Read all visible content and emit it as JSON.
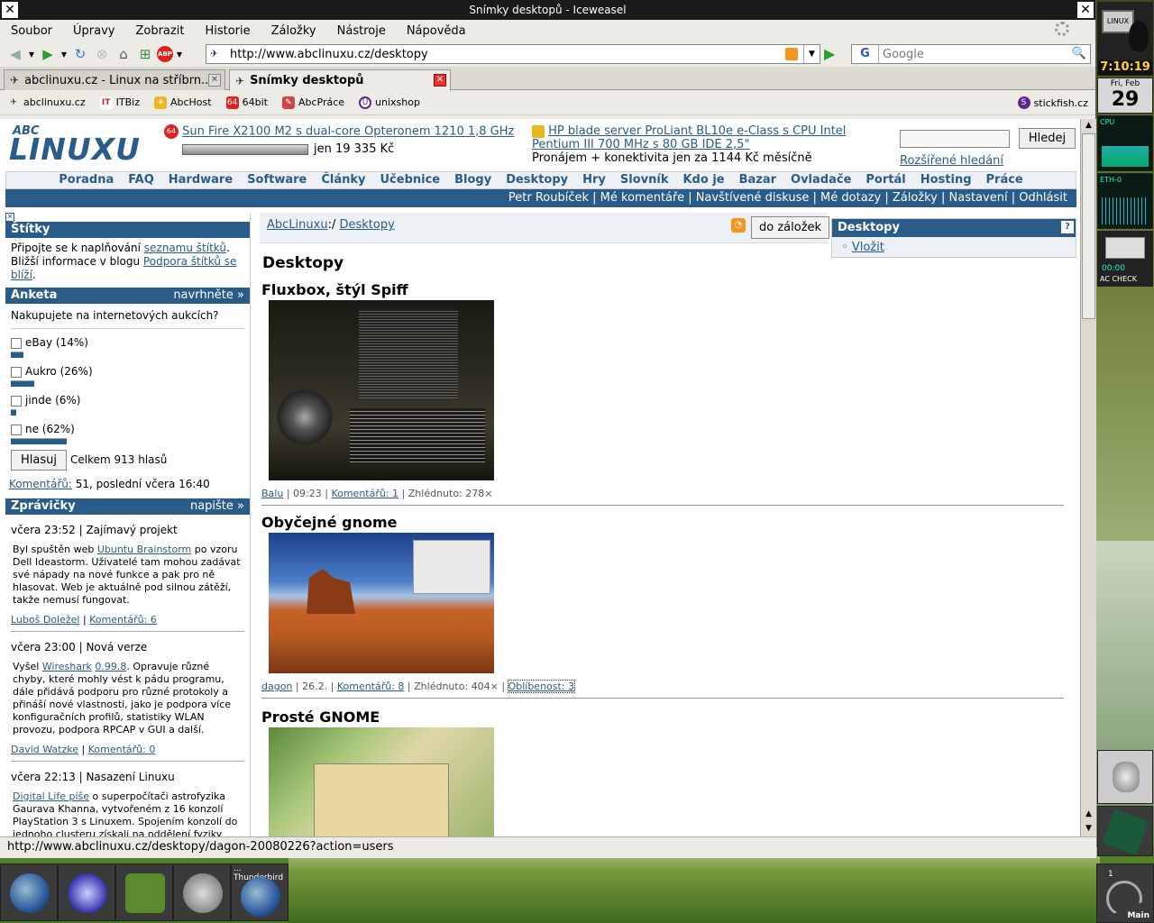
{
  "window": {
    "title": "Snímky desktopů - Iceweasel"
  },
  "menu": [
    "Soubor",
    "Úpravy",
    "Zobrazit",
    "Historie",
    "Záložky",
    "Nástroje",
    "Nápověda"
  ],
  "nav": {
    "url": "http://www.abclinuxu.cz/desktopy",
    "search_placeholder": "Google",
    "search_engine_letter": "G"
  },
  "tabs": [
    {
      "label": "abclinuxu.cz - Linux na stříbrn...",
      "active": false
    },
    {
      "label": "Snímky desktopů",
      "active": true
    }
  ],
  "bookmarks": [
    {
      "label": "abclinuxu.cz",
      "icon": "abclinuxu-icon"
    },
    {
      "label": "ITBiz",
      "icon": "itbiz-icon"
    },
    {
      "label": "AbcHost",
      "icon": "abchost-icon"
    },
    {
      "label": "64bit",
      "icon": "64bit-icon"
    },
    {
      "label": "AbcPráce",
      "icon": "abcprace-icon"
    },
    {
      "label": "unixshop",
      "icon": "unixshop-icon"
    },
    {
      "label": "stickfish.cz",
      "icon": "stickfish-icon"
    }
  ],
  "site": {
    "logo_top": "ABC",
    "logo_main": "LINUXU",
    "ad1": {
      "link": "Sun Fire X2100 M2 s dual-core Opteronem 1210 1,8 GHz",
      "price": "jen 19 335 Kč",
      "badge": "64"
    },
    "ad2": {
      "link": "HP blade server ProLiant BL10e e-Class s CPU Intel Pentium III 700 MHz s 80 GB IDE 2,5\"",
      "text": "Pronájem + konektivita jen za 1144 Kč měsíčně"
    },
    "search_button": "Hledej",
    "advanced_search": "Rozšířené hledání",
    "mainnav": [
      "Poradna",
      "FAQ",
      "Hardware",
      "Software",
      "Články",
      "Učebnice",
      "Blogy",
      "Desktopy",
      "Hry",
      "Slovník",
      "Kdo je",
      "Bazar",
      "Ovladače",
      "Portál",
      "Hosting",
      "Práce"
    ],
    "usernav": "Petr Roubíček | Mé komentáře | Navštívené diskuse | Mé dotazy | Záložky | Nastavení | Odhlásit"
  },
  "tags_box": {
    "title": "Štítky",
    "text1": "Připojte se k naplňování ",
    "link1": "seznamu štítků",
    "text2": ". Bližší informace v blogu ",
    "link2": "Podpora štítků se blíží",
    "text3": "."
  },
  "poll": {
    "title": "Anketa",
    "action": "navrhněte »",
    "question": "Nakupujete na internetových aukcích?",
    "options": [
      {
        "label": "eBay (14%)",
        "percent": 14
      },
      {
        "label": "Aukro (26%)",
        "percent": 26
      },
      {
        "label": "jinde (6%)",
        "percent": 6
      },
      {
        "label": "ne (62%)",
        "percent": 62
      }
    ],
    "vote_button": "Hlasuj",
    "total": "Celkem 913 hlasů",
    "comments_link": "Komentářů:",
    "comments_text": " 51, poslední včera 16:40"
  },
  "news": {
    "title": "Zprávičky",
    "action": "napište »",
    "items": [
      {
        "head": "včera 23:52 | Zajímavý projekt",
        "pre": "Byl spuštěn web ",
        "link": "Ubuntu Brainstorm",
        "post": " po vzoru Dell Ideastorm. Uživatelé tam mohou zadávat své nápady na nové funkce a pak pro ně hlasovat. Web je aktuálně pod silnou zátěží, takže nemusí fungovat.",
        "author": "Luboš Doležel",
        "comments": "Komentářů: 6"
      },
      {
        "head": "včera 23:00 | Nová verze",
        "pre": "Vyšel ",
        "link": "Wireshark",
        "link2": "0.99.8",
        "post": ". Opravuje různé chyby, které mohly vést k pádu programu, dále přidává podporu pro různé protokoly a přináší nové vlastnosti, jako je podpora více konfiguračních profilů, statistiky WLAN provozu, podpora RPCAP v GUI a další.",
        "author": "David Watzke",
        "comments": "Komentářů: 0"
      },
      {
        "head": "včera 22:13 | Nasazení Linuxu",
        "pre": "",
        "link": "Digital Life píše",
        "post": " o superpočítači astrofyzika Gaurava Khanna, vytvořeném z 16 konzolí PlayStation 3 s Linuxem. Spojením konzolí do jednoho clusteru získali na oddělení fyziky"
      }
    ]
  },
  "crumb": {
    "root": "AbcLinuxu",
    "sep": ":/ ",
    "current": "Desktopy",
    "bookmark_button": "do záložek"
  },
  "page_title": "Desktopy",
  "shots": [
    {
      "title": "Fluxbox, štýl Spiff",
      "author": "Balu",
      "time": "09:23",
      "comments": "Komentářů: 1",
      "views": "Zhlédnuto: 278×"
    },
    {
      "title": "Obyčejné gnome",
      "author": "dagon",
      "time": "26.2.",
      "comments": "Komentářů: 8",
      "views": "Zhlédnuto: 404×",
      "popularity": "Oblíbenost: 3"
    },
    {
      "title": "Prosté GNOME"
    }
  ],
  "rightbox": {
    "title": "Desktopy",
    "help": "?",
    "item": "Vložit"
  },
  "status": "http://www.abclinuxu.cz/desktopy/dagon-20080226?action=users",
  "dock": {
    "time": "7:10:19",
    "day": "Fri, Feb",
    "date": "29",
    "cpu": "CPU",
    "eth": "ETH-0",
    "linux": "LINUX",
    "battery": "00:00",
    "ac": "AC CHECK",
    "workspace": "1",
    "workspace_name": "Main"
  },
  "taskbar": {
    "last_label": "... Thunderbird"
  },
  "colors": {
    "brand": "#2a5c8a",
    "rss": "#f7941d",
    "close": "#e23232"
  }
}
